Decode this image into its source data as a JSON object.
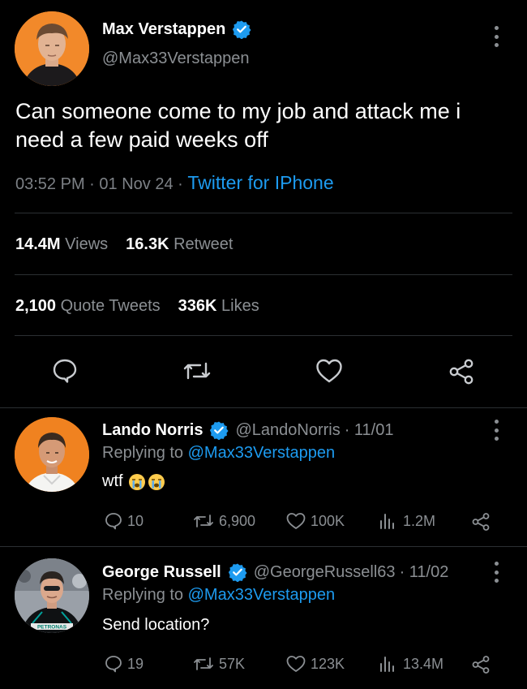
{
  "main_tweet": {
    "name": "Max Verstappen",
    "handle": "@Max33Verstappen",
    "text": "Can someone come to my job and attack me i need a few paid weeks off",
    "time": "03:52 PM",
    "date": "01 Nov 24",
    "separator": "·",
    "source": "Twitter for IPhone",
    "views_count": "14.4M",
    "views_label": "Views",
    "retweets_count": "16.3K",
    "retweets_label": "Retweet",
    "quotes_count": "2,100",
    "quotes_label": "Quote Tweets",
    "likes_count": "336K",
    "likes_label": "Likes"
  },
  "replies": [
    {
      "name": "Lando Norris",
      "handle": "@LandoNorris",
      "date": "· 11/01",
      "replying_prefix": "Replying to",
      "replying_to": "@Max33Verstappen",
      "text": "wtf",
      "reply_count": "10",
      "retweet_count": "6,900",
      "like_count": "100K",
      "view_count": "1.2M"
    },
    {
      "name": "George Russell",
      "handle": "@GeorgeRussell63",
      "date": "· 11/02",
      "replying_prefix": "Replying to",
      "replying_to": "@Max33Verstappen",
      "text": "Send location?",
      "reply_count": "19",
      "retweet_count": "57K",
      "like_count": "123K",
      "view_count": "13.4M",
      "shirt_text": "PETRONAS"
    }
  ],
  "colors": {
    "background": "#000000",
    "accent": "#1d9bf0",
    "secondary_text": "#8b8f93",
    "divider": "#2b2f33"
  },
  "icons": [
    "verified-badge-icon",
    "more-options-icon",
    "reply-icon",
    "retweet-icon",
    "like-icon",
    "share-icon",
    "views-icon",
    "loudly-crying-face-emoji"
  ]
}
